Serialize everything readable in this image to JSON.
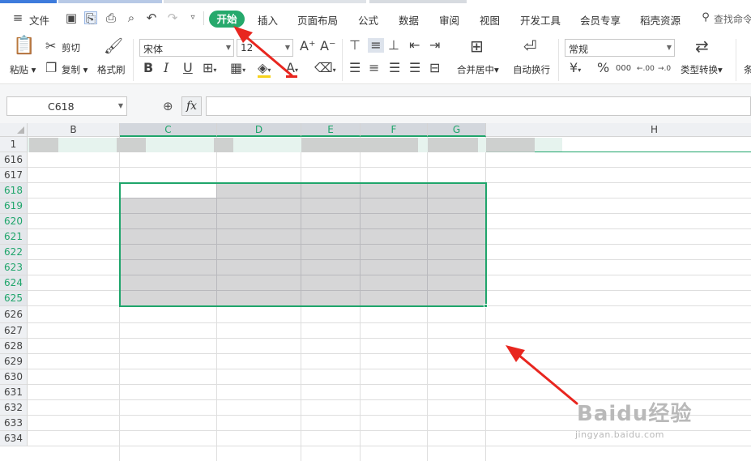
{
  "colors": {
    "accent": "#1fa56b",
    "tab_active": "#26a96c",
    "arrow": "#e8261f",
    "selection_fill": "#d6d6d7"
  },
  "menu": {
    "file": "文件",
    "tabs": [
      "开始",
      "插入",
      "页面布局",
      "公式",
      "数据",
      "审阅",
      "视图",
      "开发工具",
      "会员专享",
      "稻壳资源"
    ],
    "active_tab": "开始",
    "search_label": "查找命令"
  },
  "ribbon": {
    "paste": "粘贴",
    "cut": "剪切",
    "copy": "复制",
    "format_painter": "格式刷",
    "font_name": "宋体",
    "font_size": "12",
    "bold": "B",
    "italic": "I",
    "underline": "U",
    "font_color_glyph": "A",
    "grow_font": "A⁺",
    "shrink_font": "A⁻",
    "merge_center": "合并居中",
    "wrap_text": "自动换行",
    "number_format": "常规",
    "currency": "¥",
    "percent": "%",
    "thousands": "000",
    "dec_increase": ".00",
    "dec_decrease": ".0",
    "type_convert": "类型转换",
    "cond_partial": "条"
  },
  "formula_bar": {
    "name_box": "C618",
    "fx": "fx",
    "formula": ""
  },
  "columns": [
    "B",
    "C",
    "D",
    "E",
    "F",
    "G",
    "H"
  ],
  "selected_columns": [
    "C",
    "D",
    "E",
    "F",
    "G"
  ],
  "rows": [
    "1",
    "616",
    "617",
    "618",
    "619",
    "620",
    "621",
    "622",
    "623",
    "624",
    "625",
    "626",
    "627",
    "628",
    "629",
    "630",
    "631",
    "632",
    "633",
    "634"
  ],
  "selected_rows": [
    "618",
    "619",
    "620",
    "621",
    "622",
    "623",
    "624",
    "625"
  ],
  "active_cell": "C618",
  "selection_range": "C618:G625",
  "watermark": {
    "logo_text": "Baidu经验",
    "url": "jingyan.baidu.com"
  }
}
